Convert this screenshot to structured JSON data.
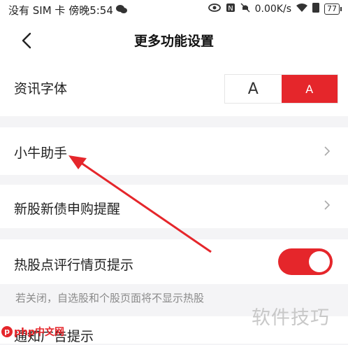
{
  "statusbar": {
    "carrier": "没有 SIM 卡 傍晚5:54",
    "network_speed": "0.00K/s",
    "battery": "77"
  },
  "header": {
    "title": "更多功能设置"
  },
  "font_setting": {
    "label": "资讯字体",
    "small_label": "A",
    "large_label": "A",
    "selected": "large"
  },
  "rows": {
    "assistant": "小牛助手",
    "new_stock": "新股新债申购提醒",
    "hot_stock": "热股点评行情页提示",
    "hot_stock_enabled": true,
    "hot_stock_hint": "若关闭，自选股和个股页面将不显示热股",
    "ad_hint": "通知广告提示"
  },
  "watermark": {
    "text": "软件技巧",
    "logo": "php中文网"
  },
  "colors": {
    "accent": "#e5262b",
    "background": "#f4f4f6"
  }
}
